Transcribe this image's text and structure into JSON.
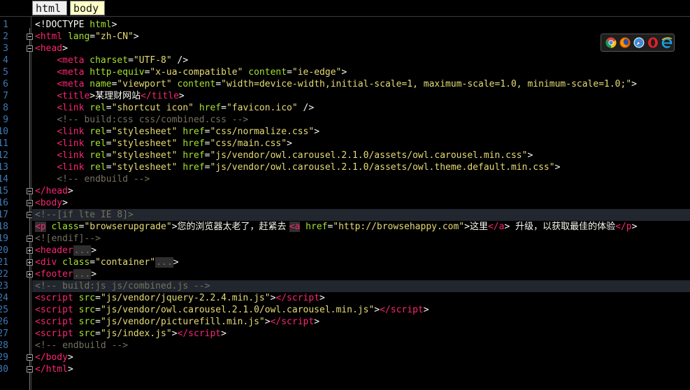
{
  "breadcrumb": [
    "html",
    "body"
  ],
  "colors": {
    "background": "#000000",
    "line_number": "#3d7ab8",
    "tag": "#f92672",
    "attribute": "#a6e22e",
    "string": "#e6db74",
    "comment": "#75715e",
    "text": "#f8f8f2",
    "highlight_line": "#22262e"
  },
  "browser_icons": [
    "chrome-icon",
    "firefox-icon",
    "safari-icon",
    "opera-icon",
    "ie-icon"
  ],
  "lines": [
    {
      "n": "1",
      "fold": "",
      "hl": false,
      "tokens": [
        [
          "txt",
          "<!DOCTYPE "
        ],
        [
          "attr",
          "html"
        ],
        [
          "txt",
          ">"
        ]
      ]
    },
    {
      "n": "2",
      "fold": "minus",
      "hl": false,
      "tokens": [
        [
          "tag",
          "<html "
        ],
        [
          "attr",
          "lang"
        ],
        [
          "eq",
          "="
        ],
        [
          "str",
          "\"zh-CN\""
        ],
        [
          "txt",
          ">"
        ]
      ]
    },
    {
      "n": "3",
      "fold": "minus",
      "hl": false,
      "tokens": [
        [
          "tag",
          "<head"
        ],
        [
          "txt",
          ">"
        ]
      ]
    },
    {
      "n": "4",
      "fold": "",
      "hl": false,
      "tokens": [
        [
          "txt",
          "    "
        ],
        [
          "tag",
          "<meta "
        ],
        [
          "attr",
          "charset"
        ],
        [
          "eq",
          "="
        ],
        [
          "str",
          "\"UTF-8\""
        ],
        [
          "txt",
          " />"
        ]
      ]
    },
    {
      "n": "5",
      "fold": "",
      "hl": false,
      "tokens": [
        [
          "txt",
          "    "
        ],
        [
          "tag",
          "<meta "
        ],
        [
          "attr",
          "http-equiv"
        ],
        [
          "eq",
          "="
        ],
        [
          "str",
          "\"x-ua-compatible\""
        ],
        [
          "txt",
          " "
        ],
        [
          "attr",
          "content"
        ],
        [
          "eq",
          "="
        ],
        [
          "str",
          "\"ie-edge\""
        ],
        [
          "txt",
          ">"
        ]
      ]
    },
    {
      "n": "6",
      "fold": "",
      "hl": false,
      "tokens": [
        [
          "txt",
          "    "
        ],
        [
          "tag",
          "<meta "
        ],
        [
          "attr",
          "name"
        ],
        [
          "eq",
          "="
        ],
        [
          "str",
          "\"viewport\""
        ],
        [
          "txt",
          " "
        ],
        [
          "attr",
          "content"
        ],
        [
          "eq",
          "="
        ],
        [
          "str",
          "\"width=device-width,initial-scale=1, maximum-scale=1.0, minimum-scale=1.0;\""
        ],
        [
          "txt",
          ">"
        ]
      ]
    },
    {
      "n": "7",
      "fold": "",
      "hl": false,
      "tokens": [
        [
          "txt",
          "    "
        ],
        [
          "tag",
          "<title"
        ],
        [
          "txt",
          ">"
        ],
        [
          "cjk",
          "某理财网站"
        ],
        [
          "tag",
          "</title"
        ],
        [
          "txt",
          ">"
        ]
      ]
    },
    {
      "n": "8",
      "fold": "",
      "hl": false,
      "tokens": [
        [
          "txt",
          "    "
        ],
        [
          "tag",
          "<link "
        ],
        [
          "attr",
          "rel"
        ],
        [
          "eq",
          "="
        ],
        [
          "str",
          "\"shortcut icon\""
        ],
        [
          "txt",
          " "
        ],
        [
          "attr",
          "href"
        ],
        [
          "eq",
          "="
        ],
        [
          "str",
          "\"favicon.ico\""
        ],
        [
          "txt",
          " />"
        ]
      ]
    },
    {
      "n": "9",
      "fold": "",
      "hl": false,
      "tokens": [
        [
          "txt",
          "    "
        ],
        [
          "com",
          "<!-- build:css css/combined.css -->"
        ]
      ]
    },
    {
      "n": "10",
      "fold": "",
      "hl": false,
      "tokens": [
        [
          "txt",
          "    "
        ],
        [
          "tag",
          "<link "
        ],
        [
          "attr",
          "rel"
        ],
        [
          "eq",
          "="
        ],
        [
          "str",
          "\"stylesheet\""
        ],
        [
          "txt",
          " "
        ],
        [
          "attr",
          "href"
        ],
        [
          "eq",
          "="
        ],
        [
          "str",
          "\"css/normalize.css\""
        ],
        [
          "txt",
          ">"
        ]
      ]
    },
    {
      "n": "11",
      "fold": "",
      "hl": false,
      "tokens": [
        [
          "txt",
          "    "
        ],
        [
          "tag",
          "<link "
        ],
        [
          "attr",
          "rel"
        ],
        [
          "eq",
          "="
        ],
        [
          "str",
          "\"stylesheet\""
        ],
        [
          "txt",
          " "
        ],
        [
          "attr",
          "href"
        ],
        [
          "eq",
          "="
        ],
        [
          "str",
          "\"css/main.css\""
        ],
        [
          "txt",
          ">"
        ]
      ]
    },
    {
      "n": "12",
      "fold": "",
      "hl": false,
      "tokens": [
        [
          "txt",
          "    "
        ],
        [
          "tag",
          "<link "
        ],
        [
          "attr",
          "rel"
        ],
        [
          "eq",
          "="
        ],
        [
          "str",
          "\"stylesheet\""
        ],
        [
          "txt",
          " "
        ],
        [
          "attr",
          "href"
        ],
        [
          "eq",
          "="
        ],
        [
          "str",
          "\"js/vendor/owl.carousel.2.1.0/assets/owl.carousel.min.css\""
        ],
        [
          "txt",
          ">"
        ]
      ]
    },
    {
      "n": "13",
      "fold": "",
      "hl": false,
      "tokens": [
        [
          "txt",
          "    "
        ],
        [
          "tag",
          "<link "
        ],
        [
          "attr",
          "rel"
        ],
        [
          "eq",
          "="
        ],
        [
          "str",
          "\"stylesheet\""
        ],
        [
          "txt",
          " "
        ],
        [
          "attr",
          "href"
        ],
        [
          "eq",
          "="
        ],
        [
          "str",
          "\"js/vendor/owl.carousel.2.1.0/assets/owl.theme.default.min.css\""
        ],
        [
          "txt",
          ">"
        ]
      ]
    },
    {
      "n": "14",
      "fold": "",
      "hl": false,
      "tokens": [
        [
          "txt",
          "    "
        ],
        [
          "com",
          "<!-- endbuild -->"
        ]
      ]
    },
    {
      "n": "15",
      "fold": "minus",
      "hl": false,
      "tokens": [
        [
          "tag",
          "</head"
        ],
        [
          "txt",
          ">"
        ]
      ]
    },
    {
      "n": "16",
      "fold": "minus",
      "hl": false,
      "tokens": [
        [
          "tag",
          "<body"
        ],
        [
          "txt",
          ">"
        ]
      ]
    },
    {
      "n": "17",
      "fold": "minus",
      "hl": true,
      "tokens": [
        [
          "com",
          "<!--[if lte IE 8]>"
        ]
      ]
    },
    {
      "n": "18",
      "fold": "",
      "hl": false,
      "tokens": [
        [
          "tagm",
          "<p"
        ],
        [
          "txt",
          " "
        ],
        [
          "attr",
          "class"
        ],
        [
          "eq",
          "="
        ],
        [
          "str",
          "\"browserupgrade\""
        ],
        [
          "txt",
          ">"
        ],
        [
          "cjk",
          "您的浏览器太老了，赶紧去 "
        ],
        [
          "tagm",
          "<a"
        ],
        [
          "txt",
          " "
        ],
        [
          "attr",
          "href"
        ],
        [
          "eq",
          "="
        ],
        [
          "str",
          "\"http://browsehappy.com\""
        ],
        [
          "txt",
          ">"
        ],
        [
          "cjk",
          "这里"
        ],
        [
          "tag",
          "</a"
        ],
        [
          "txt",
          "> "
        ],
        [
          "cjk",
          "升级，以获取最佳的体验"
        ],
        [
          "tag",
          "</p"
        ],
        [
          "txt",
          ">"
        ]
      ]
    },
    {
      "n": "19",
      "fold": "minus",
      "hl": false,
      "tokens": [
        [
          "com",
          "<![endif]-->"
        ]
      ]
    },
    {
      "n": "20",
      "fold": "plus",
      "hl": false,
      "tokens": [
        [
          "tag",
          "<header"
        ],
        [
          "col",
          "..."
        ],
        [
          "txt",
          ">"
        ]
      ]
    },
    {
      "n": "21",
      "fold": "plus",
      "hl": false,
      "tokens": [
        [
          "tag",
          "<div "
        ],
        [
          "attr",
          "class"
        ],
        [
          "eq",
          "="
        ],
        [
          "str",
          "\"container\""
        ],
        [
          "col",
          "..."
        ],
        [
          "txt",
          ">"
        ]
      ]
    },
    {
      "n": "22",
      "fold": "plus",
      "hl": false,
      "tokens": [
        [
          "tag",
          "<footer"
        ],
        [
          "col",
          "..."
        ],
        [
          "txt",
          ">"
        ]
      ]
    },
    {
      "n": "23",
      "fold": "",
      "hl": true,
      "tokens": [
        [
          "com",
          "<!-- build:js js/combined.js -->"
        ]
      ]
    },
    {
      "n": "24",
      "fold": "",
      "hl": false,
      "tokens": [
        [
          "tag",
          "<script "
        ],
        [
          "attr",
          "src"
        ],
        [
          "eq",
          "="
        ],
        [
          "str",
          "\"js/vendor/jquery-2.2.4.min.js\""
        ],
        [
          "txt",
          ">"
        ],
        [
          "tag",
          "</script"
        ],
        [
          "txt",
          ">"
        ]
      ]
    },
    {
      "n": "25",
      "fold": "",
      "hl": false,
      "tokens": [
        [
          "tag",
          "<script "
        ],
        [
          "attr",
          "src"
        ],
        [
          "eq",
          "="
        ],
        [
          "str",
          "\"js/vendor/owl.carousel.2.1.0/owl.carousel.min.js\""
        ],
        [
          "txt",
          ">"
        ],
        [
          "tag",
          "</script"
        ],
        [
          "txt",
          ">"
        ]
      ]
    },
    {
      "n": "26",
      "fold": "",
      "hl": false,
      "tokens": [
        [
          "tag",
          "<script "
        ],
        [
          "attr",
          "src"
        ],
        [
          "eq",
          "="
        ],
        [
          "str",
          "\"js/vendor/picturefill.min.js\""
        ],
        [
          "txt",
          ">"
        ],
        [
          "tag",
          "</script"
        ],
        [
          "txt",
          ">"
        ]
      ]
    },
    {
      "n": "27",
      "fold": "",
      "hl": false,
      "tokens": [
        [
          "tag",
          "<script "
        ],
        [
          "attr",
          "src"
        ],
        [
          "eq",
          "="
        ],
        [
          "str",
          "\"js/index.js\""
        ],
        [
          "txt",
          ">"
        ],
        [
          "tag",
          "</script"
        ],
        [
          "txt",
          ">"
        ]
      ]
    },
    {
      "n": "28",
      "fold": "",
      "hl": false,
      "tokens": [
        [
          "com",
          "<!-- endbuild -->"
        ]
      ]
    },
    {
      "n": "29",
      "fold": "minus",
      "hl": false,
      "tokens": [
        [
          "tag",
          "</body"
        ],
        [
          "txt",
          ">"
        ]
      ]
    },
    {
      "n": "30",
      "fold": "minus",
      "hl": false,
      "tokens": [
        [
          "tag",
          "</html"
        ],
        [
          "txt",
          ">"
        ]
      ]
    }
  ]
}
